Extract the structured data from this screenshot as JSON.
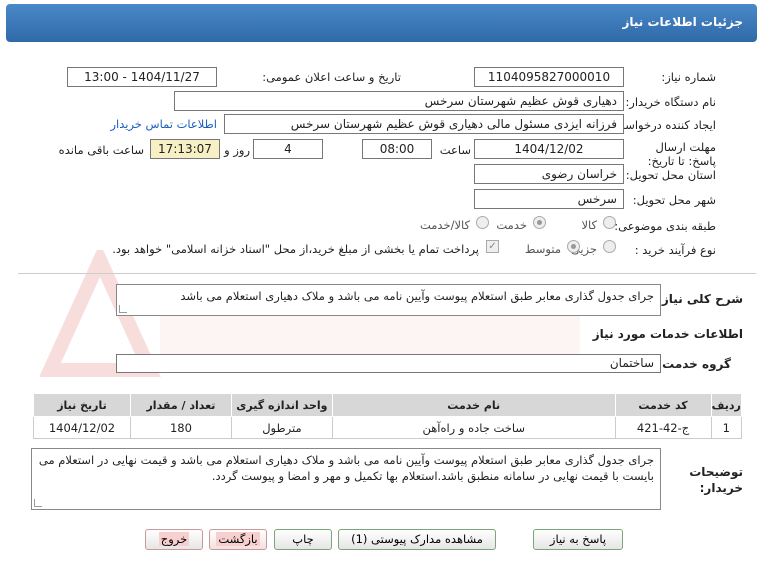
{
  "header": {
    "title": "جزئیات اطلاعات نیاز"
  },
  "form": {
    "need_number_label": "شماره نیاز:",
    "need_number": "1104095827000010",
    "announce_label": "تاریخ و ساعت اعلان عمومی:",
    "announce_value": "1404/11/27 - 13:00",
    "buyer_org_label": "نام دستگاه خریدار:",
    "buyer_org": "دهیاری قوش عظیم شهرستان سرخس",
    "creator_label": "ایجاد کننده درخواست:",
    "creator": "فرزانه ایزدی مسئول مالی دهیاری قوش عظیم شهرستان سرخس",
    "contact_link": "اطلاعات تماس خریدار",
    "deadline_label": "مهلت ارسال پاسخ: تا تاریخ:",
    "deadline_date": "1404/12/02",
    "time_label": "ساعت",
    "deadline_time": "08:00",
    "days_value": "4",
    "days_label": "روز و",
    "remaining_time": "17:13:07",
    "remaining_label": "ساعت باقی مانده",
    "province_label": "استان محل تحویل:",
    "province": "خراسان رضوی",
    "city_label": "شهر محل تحویل:",
    "city": "سرخس",
    "category_label": "طبقه بندی موضوعی:",
    "category_options": [
      "کالا",
      "خدمت",
      "کالا/خدمت"
    ],
    "category_selected": "خدمت",
    "purchase_type_label": "نوع فرآیند خرید :",
    "purchase_options": [
      "جزیی",
      "متوسط"
    ],
    "purchase_selected": "متوسط",
    "payment_note": "پرداخت تمام یا بخشی از مبلغ خرید،از محل \"اسناد خزانه اسلامی\" خواهد بود."
  },
  "summary": {
    "label": "شرح کلی نیاز:",
    "text": "جرای  جدول گذاری معابر طبق استعلام پیوست وآیین نامه می باشد و ملاک دهیاری استعلام می باشد"
  },
  "services": {
    "section_title": "اطلاعات خدمات مورد نیاز",
    "group_label": "گروه خدمت:",
    "group_value": "ساختمان",
    "columns": [
      "ردیف",
      "کد خدمت",
      "نام خدمت",
      "واحد اندازه گیری",
      "تعداد / مقدار",
      "تاریخ نیاز"
    ],
    "rows": [
      [
        "1",
        "ج-42-421",
        "ساخت جاده و راه‌آهن",
        "مترطول",
        "180",
        "1404/12/02"
      ]
    ]
  },
  "buyer_notes": {
    "label": "توضیحات خریدار:",
    "text": "جرای  جدول گذاری معابر طبق استعلام پیوست وآیین نامه می باشد و ملاک دهیاری استعلام می باشد و قیمت نهایی در استعلام می بایست با قیمت نهایی در سامانه منطبق باشد.استعلام بها تکمیل و مهر و امضا و پیوست گردد."
  },
  "buttons": {
    "respond": "پاسخ به نیاز",
    "attachments": "مشاهده مدارک پیوستی (1)",
    "print": "چاپ",
    "back": "بازگشت",
    "exit": "خروج"
  }
}
